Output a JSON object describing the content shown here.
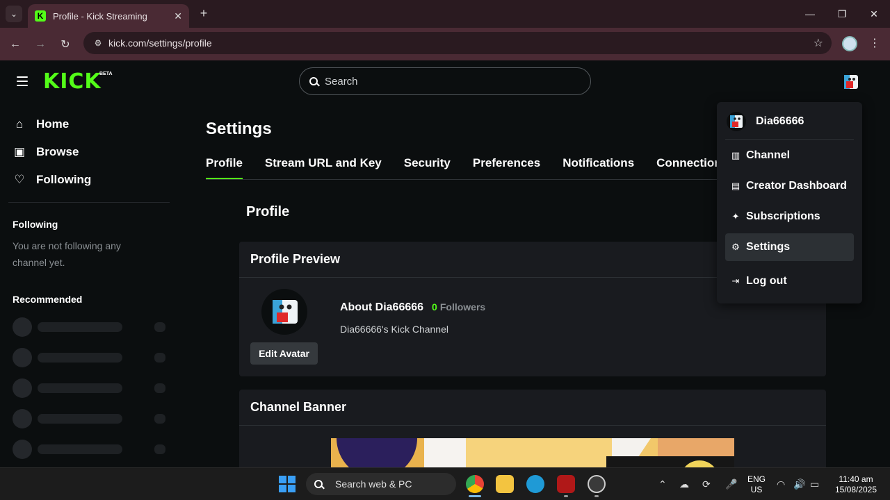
{
  "browser": {
    "tab_title": "Profile - Kick Streaming",
    "url": "kick.com/settings/profile"
  },
  "header": {
    "logo": "KICK",
    "logo_badge": "BETA",
    "search_placeholder": "Search"
  },
  "sidebar": {
    "nav": [
      {
        "label": "Home",
        "icon": "home-icon"
      },
      {
        "label": "Browse",
        "icon": "browse-icon"
      },
      {
        "label": "Following",
        "icon": "heart-icon"
      }
    ],
    "following_heading": "Following",
    "following_empty": "You are not following any channel yet.",
    "recommended_heading": "Recommended"
  },
  "main": {
    "page_title": "Settings",
    "tabs": [
      "Profile",
      "Stream URL and Key",
      "Security",
      "Preferences",
      "Notifications",
      "Connections"
    ],
    "active_tab": "Profile",
    "section_title": "Profile",
    "profile_preview": {
      "heading": "Profile Preview",
      "edit_avatar": "Edit Avatar",
      "about": "About Dia66666",
      "followers_count": "0",
      "followers_label": "Followers",
      "description": "Dia66666's Kick Channel"
    },
    "channel_banner": {
      "heading": "Channel Banner"
    }
  },
  "dropdown": {
    "username": "Dia66666",
    "items": [
      {
        "label": "Channel",
        "icon": "channel-icon"
      },
      {
        "label": "Creator Dashboard",
        "icon": "dashboard-icon"
      },
      {
        "label": "Subscriptions",
        "icon": "sparkle-icon"
      },
      {
        "label": "Settings",
        "icon": "gear-icon"
      },
      {
        "label": "Log out",
        "icon": "logout-icon"
      }
    ]
  },
  "taskbar": {
    "search_text": "Search web & PC",
    "lang_1": "ENG",
    "lang_2": "US",
    "time": "11:40 am",
    "date": "15/08/2025"
  },
  "colors": {
    "accent": "#53fc18",
    "background": "#0b0e0f",
    "card": "#191b1f"
  }
}
